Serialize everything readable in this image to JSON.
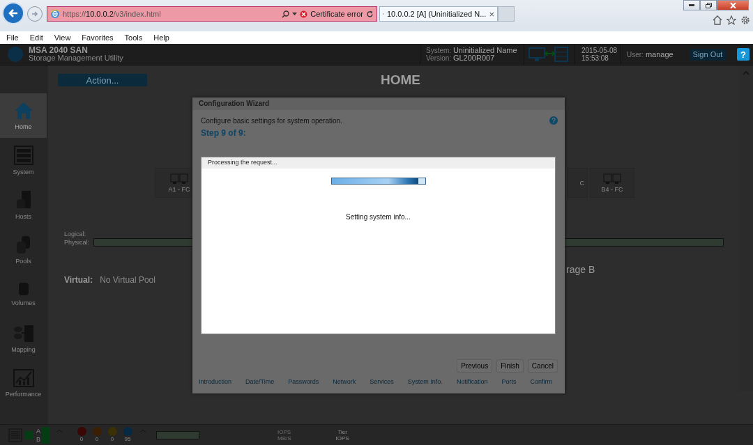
{
  "browser": {
    "url_host": "https://",
    "url_domain": "10.0.0.2",
    "url_path": "/v3/index.html",
    "cert_error": "Certificate error",
    "tabs": [
      {
        "title": "10.0.0.2 [A] (Uninitialized N...",
        "close": "×",
        "selected": true
      }
    ],
    "menu": [
      "File",
      "Edit",
      "View",
      "Favorites",
      "Tools",
      "Help"
    ]
  },
  "header": {
    "product": "MSA 2040 SAN",
    "subtitle": "Storage Management Utility",
    "system_label": "System:",
    "system_value": "Uninitialized Name",
    "version_label": "Version:",
    "version_value": "GL200R007",
    "date": "2015-05-08",
    "time": "15:53:08",
    "user_label": "User:",
    "user_value": "manage",
    "sign_out": "Sign Out",
    "help": "?"
  },
  "sidebar": [
    {
      "label": "Home",
      "kind": "home",
      "selected": true
    },
    {
      "label": "System",
      "kind": "system",
      "selected": false
    },
    {
      "label": "Hosts",
      "kind": "hosts",
      "selected": false
    },
    {
      "label": "Pools",
      "kind": "pools",
      "selected": false
    },
    {
      "label": "Volumes",
      "kind": "volumes",
      "selected": false
    },
    {
      "label": "Mapping",
      "kind": "mapping",
      "selected": false
    },
    {
      "label": "Performance",
      "kind": "performance",
      "selected": false
    }
  ],
  "content": {
    "action": "Action...",
    "title": "HOME",
    "ports_left": [
      "A1 - FC"
    ],
    "ports_right": [
      "C",
      "B4 - FC"
    ],
    "logical": "Logical:",
    "physical": "Physical:",
    "storage_b": "rage B",
    "virtual_label": "Virtual:",
    "virtual_value": "No Virtual Pool"
  },
  "wizard": {
    "title": "Configuration Wizard",
    "intro": "Configure basic settings for system operation.",
    "help": "?",
    "step": "Step 9 of 9:",
    "processing": {
      "title": "Processing the request...",
      "level": 0.93,
      "message": "Setting system info..."
    },
    "buttons": [
      "Previous",
      "Finish",
      "Cancel"
    ],
    "steps": [
      "Introduction",
      "Date/Time",
      "Passwords",
      "Network",
      "Services",
      "System Info.",
      "Notification",
      "Ports",
      "Confirm"
    ]
  },
  "status_bar": {
    "controllers": [
      "A",
      "B"
    ],
    "counts": [
      {
        "kind": "critical",
        "value": "0"
      },
      {
        "kind": "error",
        "value": "0"
      },
      {
        "kind": "warning",
        "value": "0"
      },
      {
        "kind": "info",
        "value": "95"
      }
    ],
    "perf": [
      "IOPS",
      "MB/S"
    ],
    "tier": [
      "Tier",
      "IOPS"
    ]
  }
}
